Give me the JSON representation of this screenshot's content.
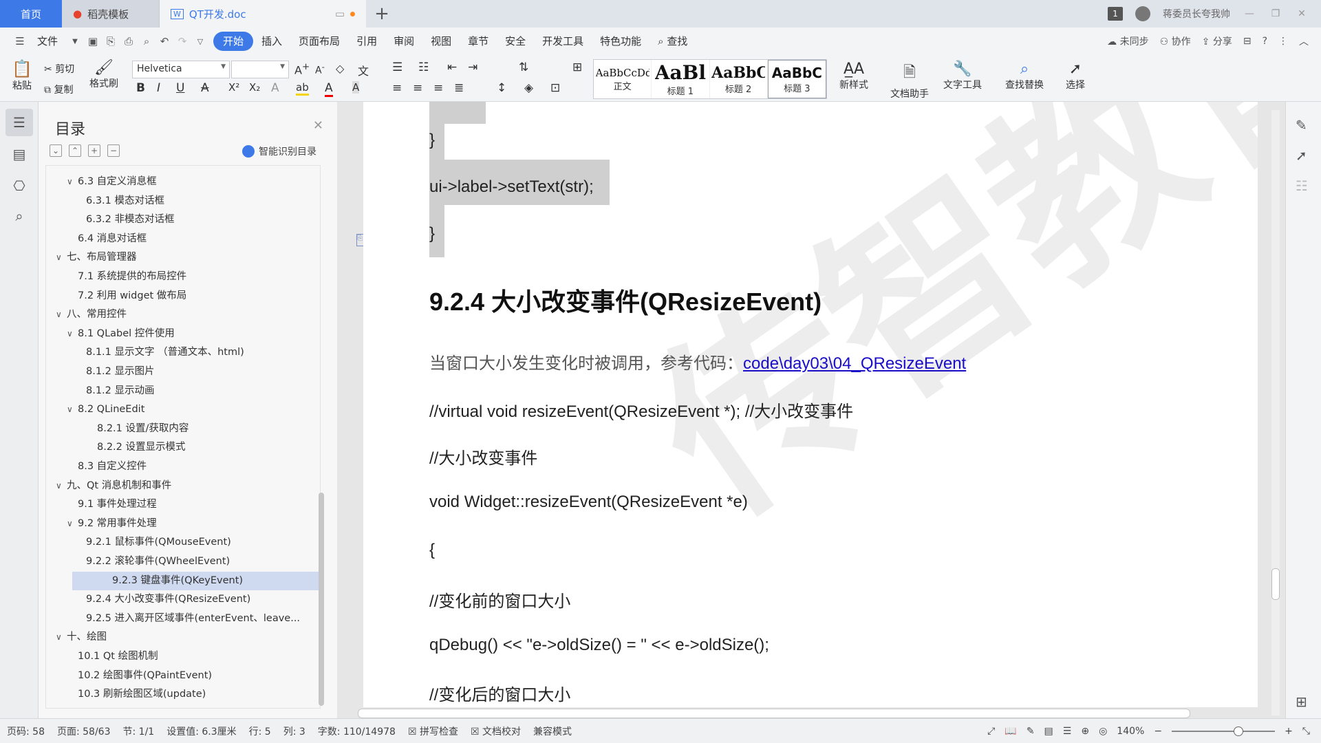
{
  "titlebar": {
    "tabs": [
      {
        "label": "首页"
      },
      {
        "label": "稻壳模板"
      },
      {
        "label": "QT开发.doc"
      }
    ],
    "window_badge": "1",
    "user_name": "蒋委员长夸我帅"
  },
  "menubar": {
    "file_label": "文件",
    "items": [
      "开始",
      "插入",
      "页面布局",
      "引用",
      "审阅",
      "视图",
      "章节",
      "安全",
      "开发工具",
      "特色功能"
    ],
    "active": "开始",
    "search_label": "查找",
    "sync_label": "未同步",
    "collab_label": "协作",
    "share_label": "分享"
  },
  "ribbon": {
    "paste": "粘贴",
    "cut": "剪切",
    "copy": "复制",
    "format_painter": "格式刷",
    "font_name": "Helvetica",
    "font_size": "",
    "styles": [
      {
        "sample": "AaBbCcDd",
        "label": "正文"
      },
      {
        "sample": "AaBl",
        "label": "标题 1"
      },
      {
        "sample": "AaBbC",
        "label": "标题 2"
      },
      {
        "sample": "AaBbC",
        "label": "标题 3"
      }
    ],
    "new_style": "新样式",
    "doc_helper": "文档助手",
    "text_tools": "文字工具",
    "find_replace": "查找替换",
    "select": "选择"
  },
  "toc": {
    "title": "目录",
    "smart_label": "智能识别目录",
    "items": [
      {
        "label": "6.3  自定义消息框",
        "level": 2,
        "expanded": true
      },
      {
        "label": "6.3.1 模态对话框",
        "level": 3
      },
      {
        "label": "6.3.2 非模态对话框",
        "level": 3
      },
      {
        "label": "6.4  消息对话框",
        "level": 2
      },
      {
        "label": "七、布局管理器",
        "level": 1,
        "expanded": true
      },
      {
        "label": "7.1  系统提供的布局控件",
        "level": 2
      },
      {
        "label": "7.2  利用 widget 做布局",
        "level": 2
      },
      {
        "label": "八、常用控件",
        "level": 1,
        "expanded": true
      },
      {
        "label": "8.1 QLabel 控件使用",
        "level": 2,
        "expanded": true
      },
      {
        "label": "8.1.1 显示文字  （普通文本、html)",
        "level": 3
      },
      {
        "label": "8.1.2 显示图片",
        "level": 3
      },
      {
        "label": "8.1.2 显示动画",
        "level": 3
      },
      {
        "label": "8.2 QLineEdit",
        "level": 2,
        "expanded": true
      },
      {
        "label": "8.2.1 设置/获取内容",
        "level": 4
      },
      {
        "label": "8.2.2 设置显示模式",
        "level": 4
      },
      {
        "label": "8.3  自定义控件",
        "level": 2
      },
      {
        "label": "九、Qt 消息机制和事件",
        "level": 1,
        "expanded": true
      },
      {
        "label": "9.1  事件处理过程",
        "level": 2
      },
      {
        "label": "9.2  常用事件处理",
        "level": 2,
        "expanded": true
      },
      {
        "label": "9.2.1  鼠标事件(QMouseEvent)",
        "level": 3
      },
      {
        "label": "9.2.2  滚轮事件(QWheelEvent)",
        "level": 3
      },
      {
        "label": "9.2.3  键盘事件(QKeyEvent)",
        "level": 3,
        "selected": true
      },
      {
        "label": "9.2.4  大小改变事件(QResizeEvent)",
        "level": 3
      },
      {
        "label": "9.2.5  进入离开区域事件(enterEvent、leave...",
        "level": 3
      },
      {
        "label": "十、绘图",
        "level": 1,
        "expanded": true
      },
      {
        "label": "10.1 Qt 绘图机制",
        "level": 2
      },
      {
        "label": "10.2  绘图事件(QPaintEvent)",
        "level": 2
      },
      {
        "label": "10.3  刷新绘图区域(update)",
        "level": 2
      }
    ]
  },
  "document": {
    "code_brace_close_1": "}",
    "code_settext": "ui->label->setText(str);",
    "code_brace_close_2": "}",
    "heading": "9.2.4  大小改变事件(QResizeEvent)",
    "para_intro": "当窗口大小发生变化时被调用，参考代码：",
    "para_link": "code\\day03\\04_QResizeEvent",
    "line_virtual": "//virtual void resizeEvent(QResizeEvent *); //大小改变事件",
    "line_comment1": "//大小改变事件",
    "line_func": "void Widget::resizeEvent(QResizeEvent *e)",
    "line_open_brace": "{",
    "line_comment2": "//变化前的窗口大小",
    "line_qdebug": "qDebug() << \"e->oldSize() = \" << e->oldSize();",
    "line_comment3": "//变化后的窗口大小",
    "watermark": "传智教育"
  },
  "statusbar": {
    "page_num": "页码: 58",
    "page_of": "页面: 58/63",
    "section": "节: 1/1",
    "setting": "设置值: 6.3厘米",
    "row": "行: 5",
    "col": "列: 3",
    "wordcount": "字数: 110/14978",
    "spellcheck": "拼写检查",
    "proofread": "文档校对",
    "compat": "兼容模式",
    "zoom": "140%"
  },
  "colors": {
    "accent": "#3d7ae8",
    "toc_selected": "#cfd9ef",
    "link": "#1a0dc8"
  }
}
